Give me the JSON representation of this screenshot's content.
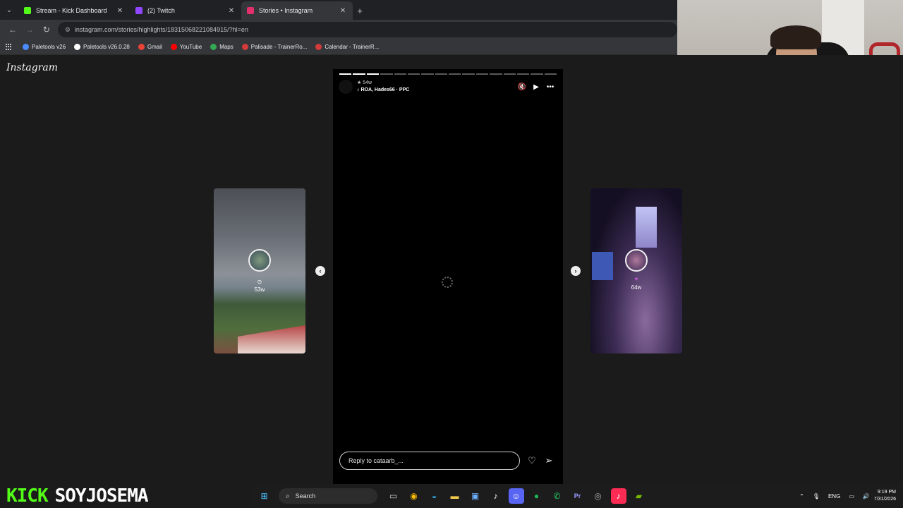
{
  "browser": {
    "tabs": [
      {
        "title": "Stream - Kick Dashboard",
        "color": "#53fc18",
        "active": false
      },
      {
        "title": "(2) Twitch",
        "color": "#9146ff",
        "active": false
      },
      {
        "title": "Stories • Instagram",
        "color": "#e1306c",
        "active": true
      }
    ],
    "url": "instagram.com/stories/highlights/18315068221084915/?hl=en",
    "bookmarks": [
      {
        "label": "Paletools v26",
        "color": "#4a8cff"
      },
      {
        "label": "Paletools v26.0.28",
        "color": "#ffffff"
      },
      {
        "label": "Gmail",
        "color": "#ea4335"
      },
      {
        "label": "YouTube",
        "color": "#ff0000"
      },
      {
        "label": "Maps",
        "color": "#34a853"
      },
      {
        "label": "Palisade - TrainerRo...",
        "color": "#d33b3b"
      },
      {
        "label": "Calendar - TrainerR...",
        "color": "#d33b3b"
      }
    ]
  },
  "instagram": {
    "logo": "Instagram",
    "story": {
      "time": "54w",
      "music": "ROA, Hades66 · PPC",
      "progress_total": 16,
      "progress_done": 3,
      "reply_placeholder": "Reply to cataarb_..."
    },
    "prev_card": {
      "time": "53w"
    },
    "next_card": {
      "time": "64w"
    }
  },
  "overlay": {
    "brand": "KICK",
    "username": "SOYJOSEMA"
  },
  "taskbar": {
    "search_placeholder": "Search",
    "language": "ENG",
    "time": "9:19 PM",
    "date": "7/31/2026"
  }
}
